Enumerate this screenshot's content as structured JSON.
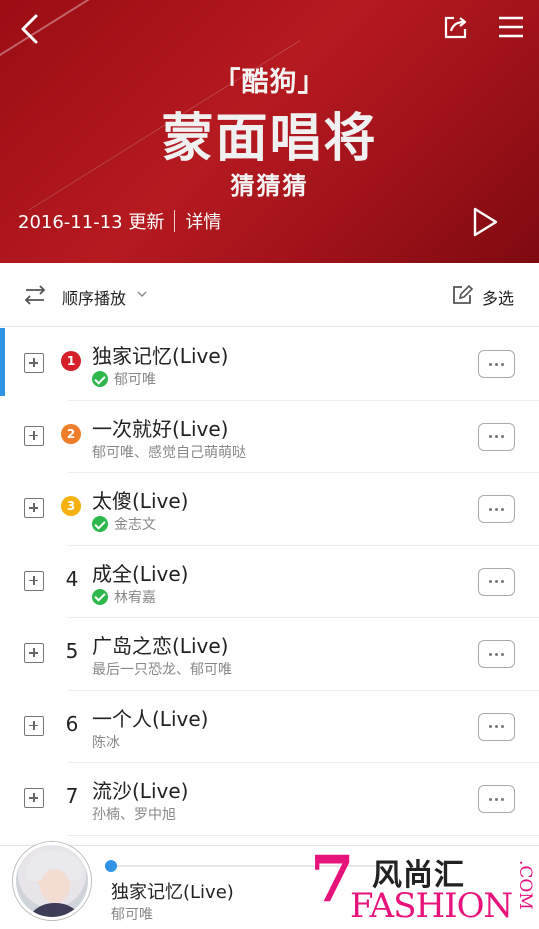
{
  "banner": {
    "brand_sub": "「酷狗」",
    "brand_title": "蒙面唱将",
    "brand_tag": "猜猜猜",
    "update_date": "2016-11-13 更新",
    "details_link": "详情",
    "bg_color": "#a8121a"
  },
  "toolbar": {
    "play_order_label": "顺序播放",
    "multi_select_label": "多选"
  },
  "songs": [
    {
      "rank": "1",
      "title": "独家记忆(Live)",
      "artist": "郁可唯",
      "verified": true,
      "active": true
    },
    {
      "rank": "2",
      "title": "一次就好(Live)",
      "artist": "郁可唯、感觉自己萌萌哒",
      "verified": false
    },
    {
      "rank": "3",
      "title": "太傻(Live)",
      "artist": "金志文",
      "verified": true
    },
    {
      "rank": "4",
      "title": "成全(Live)",
      "artist": "林宥嘉",
      "verified": true
    },
    {
      "rank": "5",
      "title": "广岛之恋(Live)",
      "artist": "最后一只恐龙、郁可唯",
      "verified": false
    },
    {
      "rank": "6",
      "title": "一个人(Live)",
      "artist": "陈冰",
      "verified": false
    },
    {
      "rank": "7",
      "title": "流沙(Live)",
      "artist": "孙楠、罗中旭",
      "verified": false
    }
  ],
  "player": {
    "title": "独家记忆(Live)",
    "artist": "郁可唯",
    "progress": 0.0
  },
  "watermark": {
    "digit": "7",
    "cn": "风尚汇",
    "en": "FASHION",
    "com": ".COM"
  },
  "colors": {
    "accent": "#2f93e6",
    "rank1": "#d5202a",
    "rank2": "#f07d2a",
    "rank3": "#f5b20f",
    "verified": "#2db84d",
    "watermark": "#e8127b"
  }
}
